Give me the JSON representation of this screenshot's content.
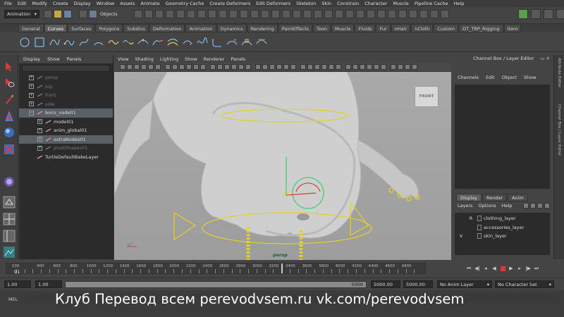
{
  "menubar": {
    "items": [
      "File",
      "Edit",
      "Modify",
      "Create",
      "Display",
      "Window",
      "Assets",
      "Animate",
      "Geometry Cache",
      "Create Deformers",
      "Edit Deformers",
      "Skeleton",
      "Skin",
      "Constrain",
      "Character",
      "Muscle",
      "Pipeline Cache",
      "Help"
    ]
  },
  "statusline": {
    "mode_value": "Animation",
    "objects_label": "Objects"
  },
  "shelf": {
    "tabs": [
      "General",
      "Curves",
      "Surfaces",
      "Polygons",
      "Subdivs",
      "Deformation",
      "Animation",
      "Dynamics",
      "Rendering",
      "PaintEffects",
      "Toon",
      "Muscle",
      "Fluids",
      "Fur",
      "nHair",
      "nCloth",
      "Custom",
      "DT_TRP_Rigging",
      "Item"
    ],
    "active_tab": "Curves"
  },
  "outliner": {
    "menu": [
      "Display",
      "Show",
      "Panels"
    ],
    "rows": [
      {
        "label": "persp",
        "dim": true,
        "selected": false,
        "indent": 0,
        "expander": true
      },
      {
        "label": "top",
        "dim": true,
        "selected": false,
        "indent": 0,
        "expander": true
      },
      {
        "label": "front",
        "dim": true,
        "selected": false,
        "indent": 0,
        "expander": true
      },
      {
        "label": "side",
        "dim": true,
        "selected": false,
        "indent": 0,
        "expander": true
      },
      {
        "label": "boris_node01",
        "dim": false,
        "selected": true,
        "indent": 0,
        "expander": true,
        "expanded": true
      },
      {
        "label": "model01",
        "dim": false,
        "selected": false,
        "indent": 1,
        "expander": true
      },
      {
        "label": "anim_global01",
        "dim": false,
        "selected": false,
        "indent": 1,
        "expander": true
      },
      {
        "label": "extraNodes01",
        "dim": false,
        "selected": true,
        "indent": 1,
        "expander": true
      },
      {
        "label": "pivotShapes01",
        "dim": true,
        "selected": false,
        "indent": 1,
        "expander": true
      },
      {
        "label": "TurtleDefaultBakeLayer",
        "dim": false,
        "selected": false,
        "indent": 0,
        "expander": false
      }
    ]
  },
  "viewport": {
    "menu": [
      "View",
      "Shading",
      "Lighting",
      "Show",
      "Renderer",
      "Panels"
    ],
    "camera_label": "persp",
    "viewcube_label": "FRONT"
  },
  "channel_box": {
    "title": "Channel Box / Layer Editor",
    "menu": [
      "Channels",
      "Edit",
      "Object",
      "Show"
    ]
  },
  "layer_editor": {
    "tabs": [
      "Display",
      "Render",
      "Anim"
    ],
    "active_tab": "Display",
    "menu": [
      "Layers",
      "Options",
      "Help"
    ],
    "layers": [
      {
        "v": "",
        "r": "R",
        "name": "clothing_layer"
      },
      {
        "v": "",
        "r": "",
        "name": "accessories_layer"
      },
      {
        "v": "V",
        "r": "",
        "name": "skin_layer"
      }
    ]
  },
  "side_strip": {
    "attribute_editor": "Attribute Editor",
    "channel_box": "Channel Box / Layer Editor"
  },
  "timeslider": {
    "ticks": [
      "100",
      "200",
      "300",
      "400",
      "500",
      "600",
      "700",
      "800",
      "900",
      "1000",
      "1100",
      "1200",
      "1300",
      "1400",
      "1500",
      "1600",
      "1700",
      "1800",
      "1900",
      "2000",
      "2100",
      "2200",
      "2300",
      "2400",
      "2500",
      "2600",
      "2700",
      "2800",
      "2900",
      "3000",
      "3100",
      "3200",
      "3300",
      "3400",
      "3500",
      "3600",
      "3700",
      "3800",
      "3900",
      "4000",
      "4100",
      "4200",
      "4300",
      "4400",
      "4500",
      "4600",
      "4700",
      "4800",
      "4900"
    ],
    "tick_labels": [
      "100",
      "400",
      "600",
      "800",
      "1000",
      "1200",
      "1400",
      "1600",
      "1800",
      "2000",
      "2200",
      "2400",
      "2600",
      "2800",
      "3000",
      "3200",
      "3400",
      "3600",
      "3800",
      "4000",
      "4200",
      "4400",
      "4600",
      "4800"
    ],
    "current_frame": "91",
    "playhead_frame": "3300"
  },
  "rangeslider": {
    "start": "1.00",
    "inner_start": "1.00",
    "inner_end": "5000",
    "end_a": "5000.00",
    "end_b": "5000.00",
    "anim_layer": "No Anim Layer",
    "character_set": "No Character Set"
  },
  "cmdline": {
    "label": "MEL",
    "watermark": "Клуб Перевод всем   perevodvsem.ru   vk.com/perevodvsem"
  },
  "colors": {
    "accent_selected": "#5b5f66",
    "rig_yellow": "#e6d21e",
    "skin": "#c9c9c9"
  }
}
